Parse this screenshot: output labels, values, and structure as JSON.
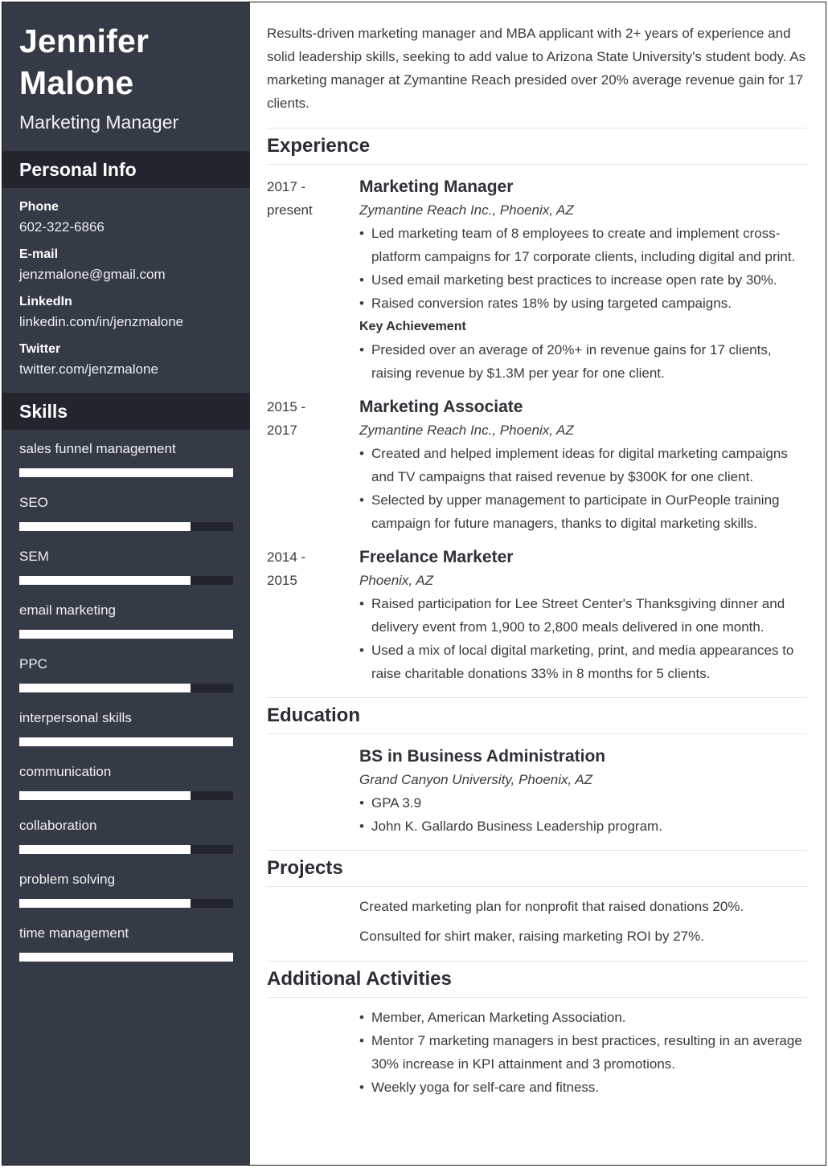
{
  "profile": {
    "first_name": "Jennifer",
    "last_name": "Malone",
    "title": "Marketing Manager"
  },
  "personal_info": {
    "heading": "Personal Info",
    "items": [
      {
        "label": "Phone",
        "value": "602-322-6866"
      },
      {
        "label": "E-mail",
        "value": "jenzmalone@gmail.com"
      },
      {
        "label": "LinkedIn",
        "value": "linkedin.com/in/jenzmalone"
      },
      {
        "label": "Twitter",
        "value": "twitter.com/jenzmalone"
      }
    ]
  },
  "skills": {
    "heading": "Skills",
    "max_level": 5,
    "items": [
      {
        "name": "sales funnel management",
        "level": 5
      },
      {
        "name": "SEO",
        "level": 4
      },
      {
        "name": "SEM",
        "level": 4
      },
      {
        "name": "email marketing",
        "level": 5
      },
      {
        "name": "PPC",
        "level": 4
      },
      {
        "name": "interpersonal skills",
        "level": 5
      },
      {
        "name": "communication",
        "level": 4
      },
      {
        "name": "collaboration",
        "level": 4
      },
      {
        "name": "problem solving",
        "level": 4
      },
      {
        "name": "time management",
        "level": 5
      }
    ]
  },
  "colors": {
    "sidebar_bg": "#343a46",
    "sidebar_band": "#22252d",
    "skill_fill": "#ffffff"
  },
  "summary": "Results-driven marketing manager and MBA applicant with 2+ years of experience and solid leadership skills, seeking to add value to Arizona State University's student body. As marketing manager at Zymantine Reach presided over 20% average revenue gain for 17 clients.",
  "experience": {
    "heading": "Experience",
    "jobs": [
      {
        "date_start": "2017 -",
        "date_end": "present",
        "title": "Marketing Manager",
        "company": "Zymantine Reach Inc., Phoenix, AZ",
        "bullets": [
          "Led marketing team of 8 employees to create and implement cross-platform campaigns for 17 corporate clients, including digital and print.",
          "Used email marketing best practices to increase open rate by 30%.",
          "Raised conversion rates 18% by using targeted campaigns."
        ],
        "key_achievement_label": "Key Achievement",
        "key_achievement_bullets": [
          "Presided over an average of 20%+ in revenue gains for 17 clients, raising revenue by $1.3M per year for one client."
        ]
      },
      {
        "date_start": "2015 -",
        "date_end": "2017",
        "title": "Marketing Associate",
        "company": "Zymantine Reach Inc., Phoenix, AZ",
        "bullets": [
          "Created and helped implement ideas for digital marketing campaigns and TV campaigns that raised revenue by $300K for one client.",
          "Selected by upper management to participate in OurPeople training campaign for future managers, thanks to digital marketing skills."
        ]
      },
      {
        "date_start": "2014 -",
        "date_end": "2015",
        "title": "Freelance Marketer",
        "company": "Phoenix, AZ",
        "bullets": [
          "Raised participation for Lee Street Center's Thanksgiving dinner and delivery event from 1,900 to 2,800 meals delivered in one month.",
          "Used a mix of local digital marketing, print, and media appearances to raise charitable donations 33% in 8 months for 5 clients."
        ]
      }
    ]
  },
  "education": {
    "heading": "Education",
    "degree": "BS in Business Administration",
    "school": "Grand Canyon University, Phoenix, AZ",
    "bullets": [
      "GPA 3.9",
      "John K. Gallardo Business Leadership program."
    ]
  },
  "projects": {
    "heading": "Projects",
    "items": [
      "Created marketing plan for nonprofit that raised donations 20%.",
      "Consulted for shirt maker, raising marketing ROI by 27%."
    ]
  },
  "activities": {
    "heading": "Additional Activities",
    "bullets": [
      "Member, American Marketing Association.",
      "Mentor 7 marketing managers in best practices, resulting in an average 30% increase in KPI attainment and 3 promotions.",
      "Weekly yoga for self-care and fitness."
    ]
  }
}
